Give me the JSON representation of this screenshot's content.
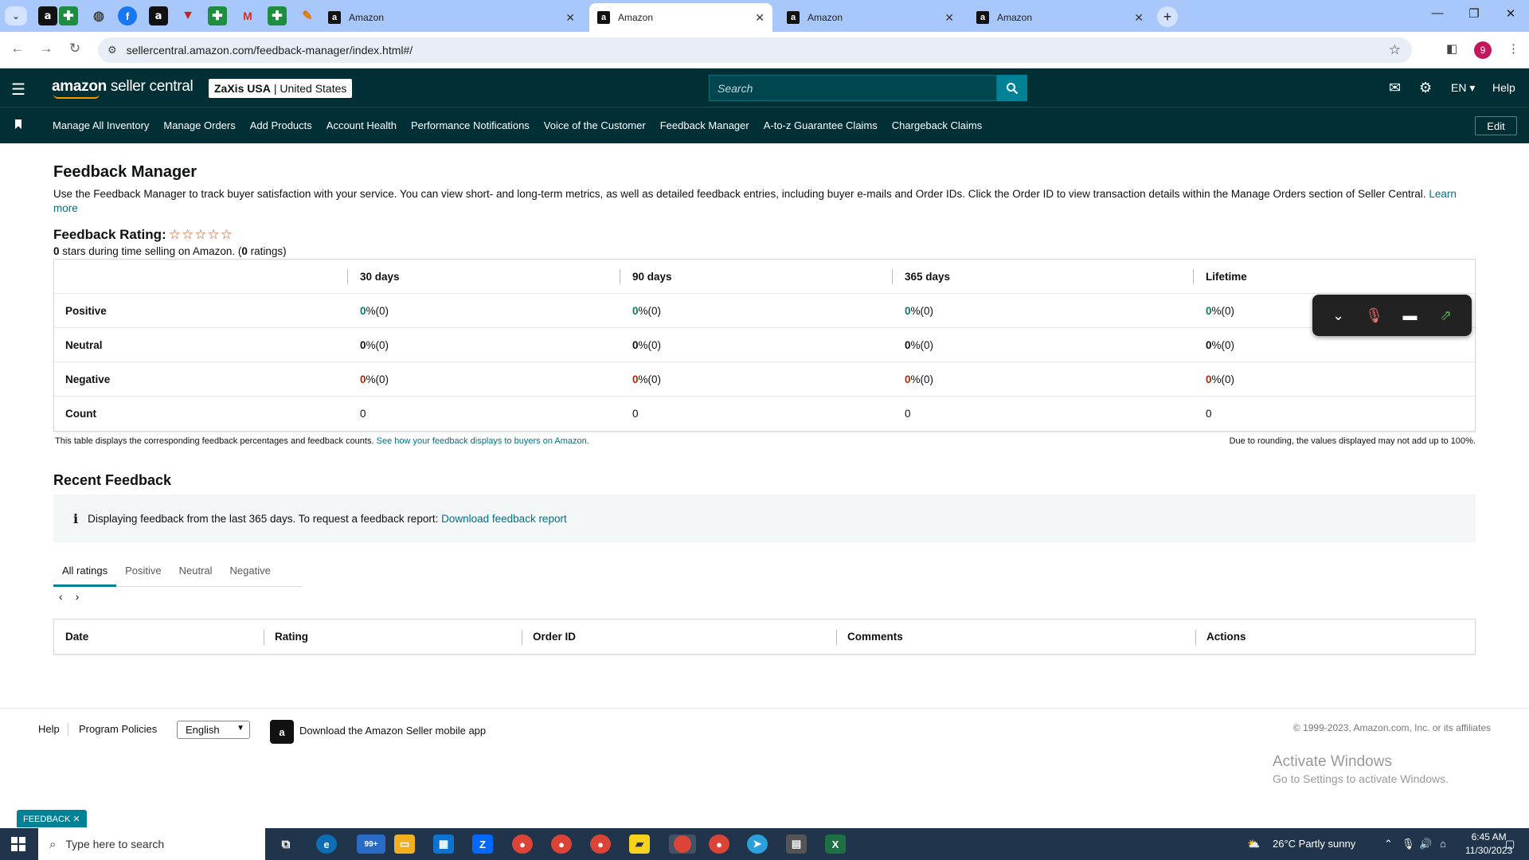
{
  "browser": {
    "tabs": [
      {
        "title": "Amazon"
      },
      {
        "title": "Amazon"
      },
      {
        "title": "Amazon"
      },
      {
        "title": "Amazon"
      }
    ],
    "url": "sellercentral.amazon.com/feedback-manager/index.html#/"
  },
  "header": {
    "logo_brand": "amazon",
    "logo_product": " seller central",
    "store_name": "ZaXis USA",
    "store_region": "| United States",
    "search_placeholder": "Search",
    "language": "EN",
    "help": "Help"
  },
  "nav": {
    "items": [
      "Manage All Inventory",
      "Manage Orders",
      "Add Products",
      "Account Health",
      "Performance Notifications",
      "Voice of the Customer",
      "Feedback Manager",
      "A-to-z Guarantee Claims",
      "Chargeback Claims"
    ],
    "edit": "Edit"
  },
  "page": {
    "title": "Feedback Manager",
    "description": "Use the Feedback Manager to track buyer satisfaction with your service. You can view short- and long-term metrics, as well as detailed feedback entries, including buyer e-mails and Order IDs. Click the Order ID to view transaction details within the Manage Orders section of Seller Central.",
    "learn_more": "Learn more",
    "rating_label": "Feedback Rating:",
    "rating_stars": 0,
    "rating_summary_stars": "0",
    "rating_summary_text": " stars during time selling on Amazon. (",
    "rating_count": "0",
    "rating_count_suffix": " ratings)"
  },
  "metrics": {
    "columns": [
      "30 days",
      "90 days",
      "365 days",
      "Lifetime"
    ],
    "rows": [
      {
        "label": "Positive",
        "type": "pos",
        "values": [
          {
            "num": "0",
            "rest": " %(0)"
          },
          {
            "num": "0",
            "rest": " %(0)"
          },
          {
            "num": "0",
            "rest": " %(0)"
          },
          {
            "num": "0",
            "rest": " %(0)"
          }
        ]
      },
      {
        "label": "Neutral",
        "type": "neu",
        "values": [
          {
            "num": "0",
            "rest": " %(0)"
          },
          {
            "num": "0",
            "rest": " %(0)"
          },
          {
            "num": "0",
            "rest": " %(0)"
          },
          {
            "num": "0",
            "rest": " %(0)"
          }
        ]
      },
      {
        "label": "Negative",
        "type": "neg",
        "values": [
          {
            "num": "0",
            "rest": " %(0)"
          },
          {
            "num": "0",
            "rest": " %(0)"
          },
          {
            "num": "0",
            "rest": " %(0)"
          },
          {
            "num": "0",
            "rest": " %(0)"
          }
        ]
      },
      {
        "label": "Count",
        "type": "count",
        "values": [
          {
            "num": "",
            "rest": "0"
          },
          {
            "num": "",
            "rest": "0"
          },
          {
            "num": "",
            "rest": "0"
          },
          {
            "num": "",
            "rest": "0"
          }
        ]
      }
    ],
    "note": "This table displays the corresponding feedback percentages and feedback counts.",
    "note_link": "See how your feedback displays to buyers on Amazon.",
    "rounding_note": "Due to rounding, the values displayed may not add up to 100%."
  },
  "recent": {
    "title": "Recent Feedback",
    "info_text": "Displaying feedback from the last 365 days. To request a feedback report:",
    "info_link": "Download feedback report",
    "tabs": [
      "All ratings",
      "Positive",
      "Neutral",
      "Negative"
    ],
    "active_tab": 0,
    "columns": [
      "Date",
      "Rating",
      "Order ID",
      "Comments",
      "Actions"
    ]
  },
  "footer": {
    "help": "Help",
    "program_policies": "Program Policies",
    "language": "English",
    "app_text": "Download the Amazon Seller mobile app",
    "copyright": "© 1999-2023, Amazon.com, Inc. or its affiliates",
    "activate_title": "Activate Windows",
    "activate_sub": "Go to Settings to activate Windows."
  },
  "feedback_badge": "FEEDBACK ✕",
  "taskbar": {
    "search_placeholder": "Type here to search",
    "mail_badge": "99+",
    "weather": "26°C  Partly sunny",
    "time": "6:45 AM",
    "date": "11/30/2023"
  },
  "colors": {
    "header_bg": "#002f36",
    "accent": "#008296",
    "positive": "#067d62",
    "negative": "#b12704"
  }
}
